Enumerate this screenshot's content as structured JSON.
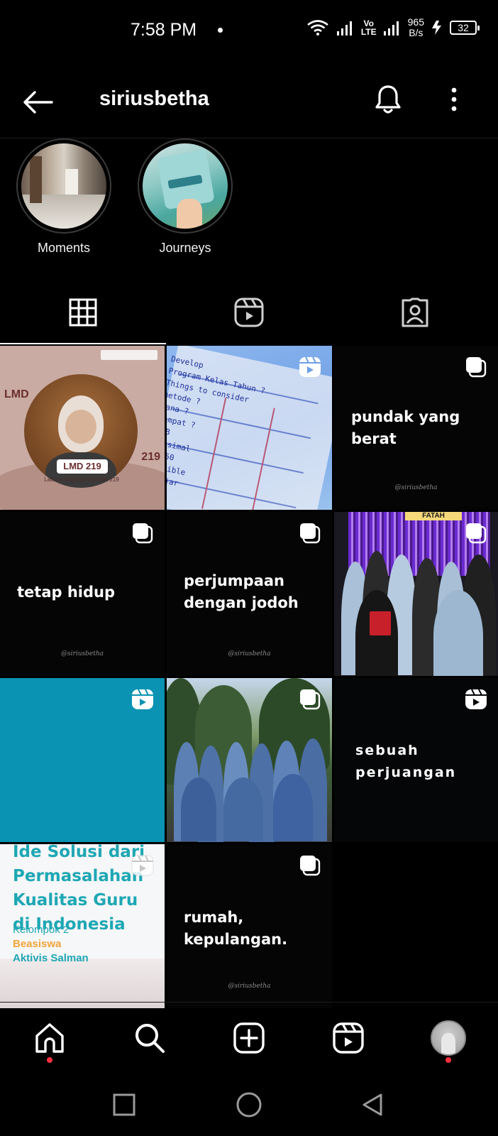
{
  "status_bar": {
    "time": "7:58 PM",
    "network_label": "Vo\nLTE",
    "net_speed": "965\nB/s",
    "battery": "32"
  },
  "header": {
    "username": "siriusbetha",
    "icons": [
      "back-arrow-icon",
      "bell-icon",
      "more-vertical-icon"
    ]
  },
  "highlights": [
    {
      "label": "Moments"
    },
    {
      "label": "Journeys"
    }
  ],
  "tabs": [
    {
      "icon": "grid-icon",
      "active": true
    },
    {
      "icon": "reels-icon",
      "active": false
    },
    {
      "icon": "tagged-icon",
      "active": false
    }
  ],
  "posts": [
    {
      "type": "image",
      "badge": "none",
      "title": "LMD 219",
      "left_text": "LMD",
      "right_text": "219",
      "subtitle": "Latihan Mujtahid Dakwah 219"
    },
    {
      "type": "image",
      "badge": "reel",
      "text": "Develop\nProgram Kelas Tahun ?\nThings to consider\nmetode ?\nDana ?\nTempat ?\nFEB\nMaksimal\n50 50\nFlexible\nbelajar\nQuran"
    },
    {
      "type": "text",
      "badge": "carousel",
      "text": "pundak yang\nberat",
      "watermark": "@siriusbetha"
    },
    {
      "type": "text",
      "badge": "carousel",
      "text": "tetap hidup",
      "watermark": "@siriusbetha"
    },
    {
      "type": "text",
      "badge": "carousel",
      "text": "perjumpaan\ndengan jodoh",
      "watermark": "@siriusbetha"
    },
    {
      "type": "image",
      "badge": "carousel",
      "banner": "FATAH"
    },
    {
      "type": "color",
      "badge": "reel",
      "color": "#0a93b3"
    },
    {
      "type": "image",
      "badge": "carousel"
    },
    {
      "type": "text",
      "badge": "reel",
      "text": "sebuah\nperjuangan"
    },
    {
      "type": "slide",
      "badge": "reel",
      "title": "Ide Solusi dari\nPermasalahan\nKualitas Guru\ndi Indonesia",
      "group": "Kelompok 2",
      "subtitle1": "Beasiswa",
      "subtitle2": "Aktivis Salman"
    },
    {
      "type": "text",
      "badge": "carousel",
      "text": "rumah,\nkepulangan.",
      "watermark": "@siriusbetha"
    }
  ],
  "bottom_nav": [
    {
      "icon": "home-icon",
      "dot": true
    },
    {
      "icon": "search-icon",
      "dot": false
    },
    {
      "icon": "create-icon",
      "dot": false
    },
    {
      "icon": "reels-icon",
      "dot": false
    },
    {
      "icon": "profile-avatar",
      "dot": true
    }
  ],
  "system_nav": [
    "recents-icon",
    "home-circle-icon",
    "back-triangle-icon"
  ],
  "colors": {
    "background": "#000000",
    "text": "#ffffff",
    "notification_dot": "#ff3040",
    "teal": "#0a93b3"
  }
}
